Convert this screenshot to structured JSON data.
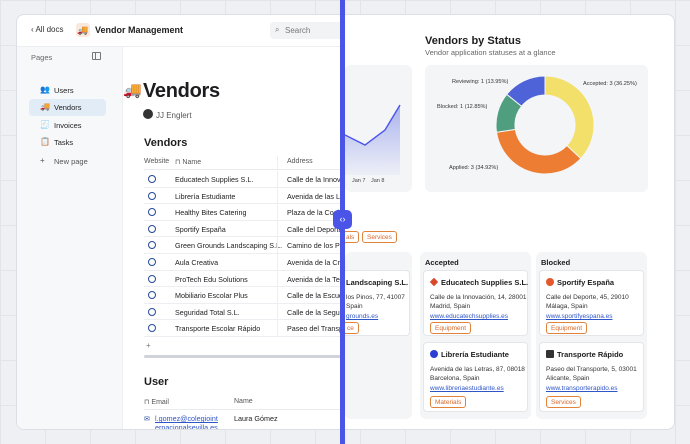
{
  "left": {
    "back_label": "All docs",
    "app_title": "Vendor Management",
    "search_placeholder": "Search",
    "sidebar": {
      "heading": "Pages",
      "items": [
        {
          "label": "Users",
          "icon": "users-icon",
          "glyph": "👥"
        },
        {
          "label": "Vendors",
          "icon": "truck-icon",
          "glyph": "🚚"
        },
        {
          "label": "Invoices",
          "icon": "invoice-icon",
          "glyph": "🧾"
        },
        {
          "label": "Tasks",
          "icon": "tasks-icon",
          "glyph": "📋"
        },
        {
          "label": "New page",
          "icon": "plus-icon",
          "glyph": "+"
        }
      ]
    },
    "page_title": "Vendors",
    "owner": "JJ Englert",
    "vendors_section": "Vendors",
    "columns": [
      "Website",
      "Name",
      "Address"
    ],
    "vendors": [
      {
        "name": "Educatech Supplies S.L.",
        "address": "Calle de la Innovación"
      },
      {
        "name": "Librería Estudiante",
        "address": "Avenida de las Letras"
      },
      {
        "name": "Healthy Bites Catering",
        "address": "Plaza de la Cocina"
      },
      {
        "name": "Sportify España",
        "address": "Calle del Deporte"
      },
      {
        "name": "Green Grounds Landscaping S.L.",
        "address": "Camino de los Pinos"
      },
      {
        "name": "Aula Creativa",
        "address": "Avenida de la Creatividad"
      },
      {
        "name": "ProTech Edu Solutions",
        "address": "Avenida de la Tecnología"
      },
      {
        "name": "Mobiliario Escolar Plus",
        "address": "Calle de la Escuela"
      },
      {
        "name": "Seguridad Total S.L.",
        "address": "Calle de la Seguridad"
      },
      {
        "name": "Transporte Escolar Rápido",
        "address": "Paseo del Transporte"
      }
    ],
    "user_section": "User",
    "user_columns": [
      "Email",
      "Name"
    ],
    "user_email": "l.gomez@colegiointernacionalsevilla.es",
    "user_name": "Laura Gómez"
  },
  "right": {
    "line_dates": [
      "Jan 7",
      "Jan 8"
    ],
    "chart_data": {
      "type": "pie",
      "title": "Vendors by Status",
      "subtitle": "Vendor application statuses at a glance",
      "labels": [
        "Accepted",
        "Applied",
        "Blocked",
        "Reviewing"
      ],
      "values": [
        3,
        3,
        1,
        1
      ],
      "percents": [
        "36.25%",
        "34.92%",
        "12.85%",
        "13.95%"
      ],
      "colors": [
        "#f3e06a",
        "#ee7d34",
        "#4f9e7f",
        "#4f63d8"
      ]
    },
    "filter_tags": [
      "als",
      "Services"
    ],
    "kanban": {
      "first_col": {
        "title": "Landscaping S.L.",
        "address": "los Pinos, 77, 41007",
        "address2": "Spain",
        "link": "grounds.es",
        "tag": "ce"
      },
      "accepted": {
        "header": "Accepted",
        "cards": [
          {
            "title": "Educatech Supplies S.L.",
            "address": "Calle de la Innovación, 14, 28001",
            "address2": "Madrid, Spain",
            "link": "www.educatechsupplies.es",
            "tag": "Equipment",
            "logo": "#d9482b"
          },
          {
            "title": "Librería Estudiante",
            "address": "Avenida de las Letras, 87, 08018",
            "address2": "Barcelona, Spain",
            "link": "www.libreriaestudiante.es",
            "tag": "Materials",
            "logo": "#2b3fd0"
          }
        ]
      },
      "blocked": {
        "header": "Blocked",
        "cards": [
          {
            "title": "Sportify España",
            "address": "Calle del Deporte, 45, 29010",
            "address2": "Málaga, Spain",
            "link": "www.sportifyespana.es",
            "tag": "Equipment",
            "logo": "#e5582b"
          },
          {
            "title": "Transporte Rápido",
            "address": "Paseo del Transporte, 5, 03001",
            "address2": "Alicante, Spain",
            "link": "www.transporterapido.es",
            "tag": "Services",
            "logo": "#333333"
          }
        ]
      }
    }
  }
}
